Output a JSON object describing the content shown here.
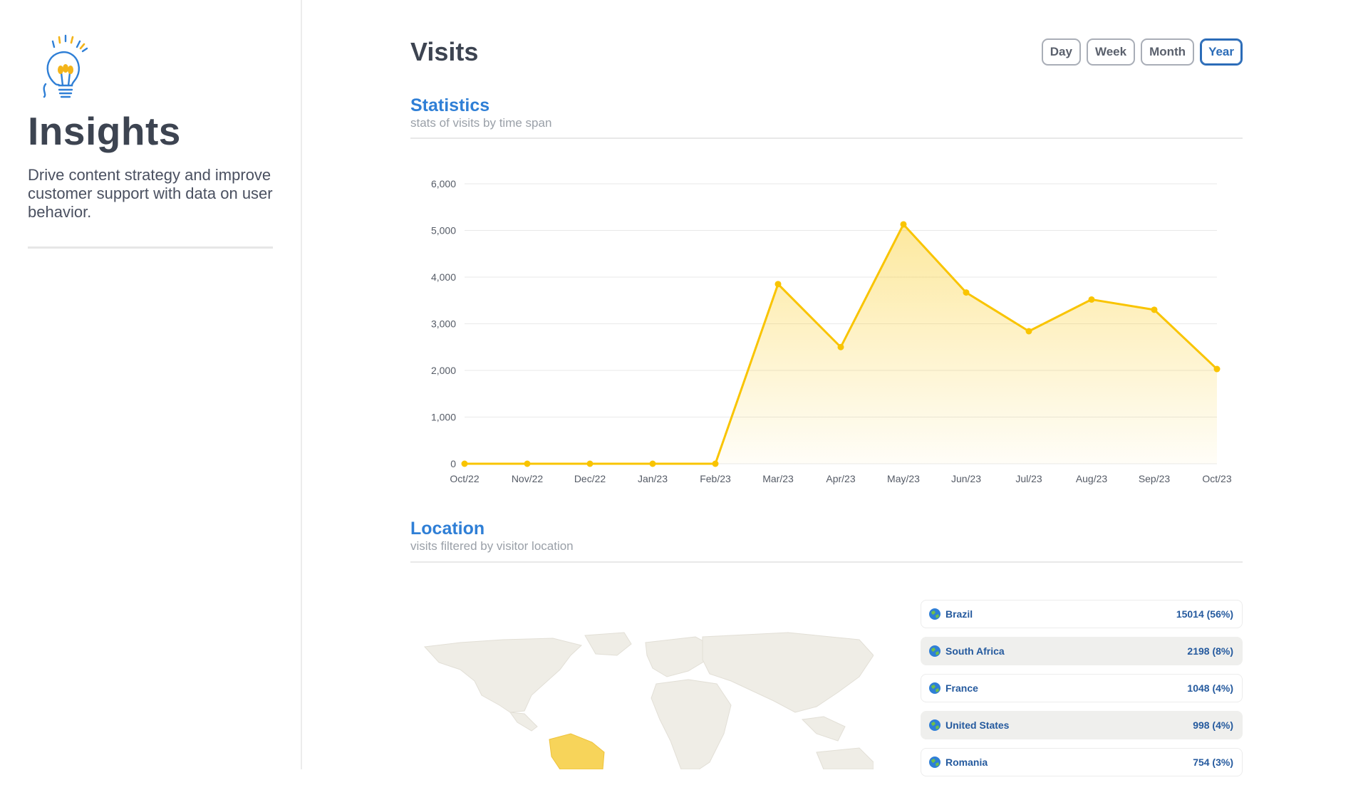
{
  "sidebar": {
    "title": "Insights",
    "description": "Drive content strategy and improve customer support with data on user behavior."
  },
  "main": {
    "title": "Visits",
    "ranges": [
      "Day",
      "Week",
      "Month",
      "Year"
    ],
    "active_range": "Year"
  },
  "statistics": {
    "title": "Statistics",
    "subtitle": "stats of visits by time span"
  },
  "chart_data": {
    "type": "area",
    "categories": [
      "Oct/22",
      "Nov/22",
      "Dec/22",
      "Jan/23",
      "Feb/23",
      "Mar/23",
      "Apr/23",
      "May/23",
      "Jun/23",
      "Jul/23",
      "Aug/23",
      "Sep/23",
      "Oct/23"
    ],
    "series": [
      {
        "values": [
          0,
          0,
          0,
          0,
          0,
          3850,
          2500,
          5130,
          3670,
          2840,
          3520,
          3300,
          2030
        ]
      }
    ],
    "ylim": [
      0,
      6000
    ],
    "yticks": [
      "0",
      "1,000",
      "2,000",
      "3,000",
      "4,000",
      "5,000",
      "6,000"
    ],
    "grid": true,
    "color": "#f9c400"
  },
  "location": {
    "title": "Location",
    "subtitle": "visits filtered by visitor location",
    "countries": [
      {
        "name": "Brazil",
        "value": "15014 (56%)"
      },
      {
        "name": "South Africa",
        "value": "2198 (8%)"
      },
      {
        "name": "France",
        "value": "1048 (4%)"
      },
      {
        "name": "United States",
        "value": "998 (4%)"
      },
      {
        "name": "Romania",
        "value": "754 (3%)"
      }
    ]
  },
  "colors": {
    "accent": "#2f7fd6",
    "highlight": "#f9c400",
    "map_land": "#efede6",
    "map_highlight": "#f7d45a"
  }
}
